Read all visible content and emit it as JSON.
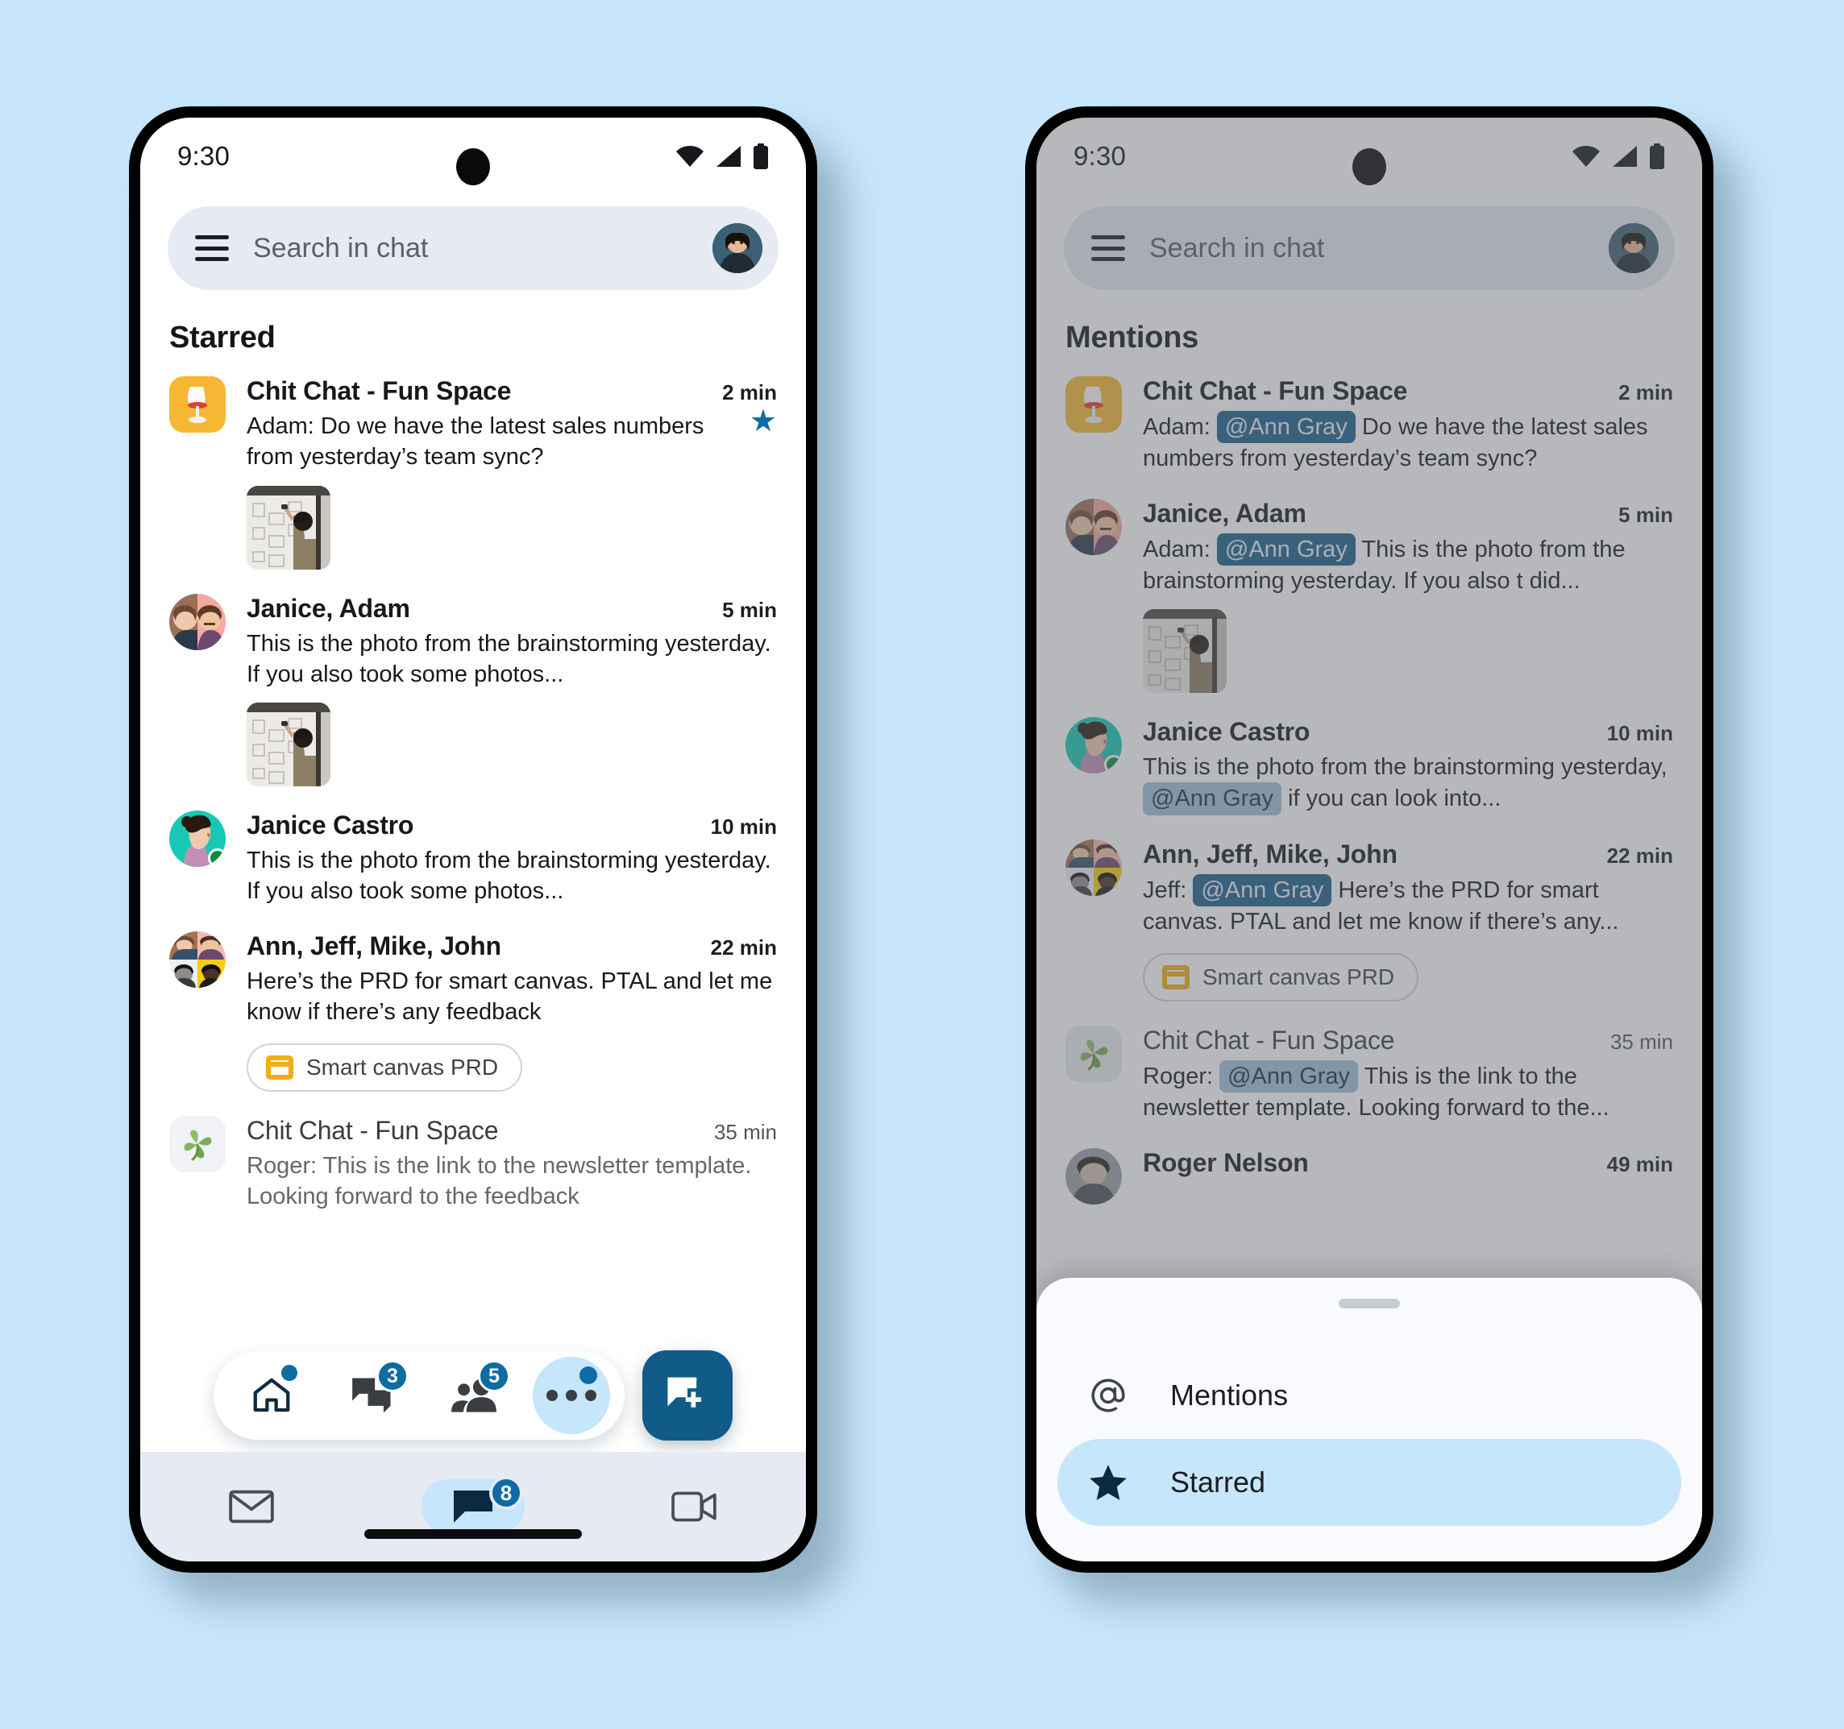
{
  "background_color": "#c7e6fb",
  "accent_color": "#0e6ba3",
  "phones": [
    {
      "id": "starred-phone",
      "status_bar": {
        "time": "9:30",
        "icons": [
          "wifi-icon",
          "signal-icon",
          "battery-icon"
        ]
      },
      "search": {
        "placeholder": "Search in chat",
        "menu_icon": "hamburger-icon",
        "avatar": "user-avatar"
      },
      "section_title": "Starred",
      "rows": [
        {
          "avatar": {
            "type": "square",
            "bg": "#f6b733",
            "glyph": "chair-icon"
          },
          "name": "Chit Chat - Fun Space",
          "time": "2 min",
          "snippet": "Adam: Do we have the latest sales numbers from yesterday’s team sync?",
          "starred": true,
          "has_thumb": true,
          "read": false
        },
        {
          "avatar": {
            "type": "split"
          },
          "name": "Janice, Adam",
          "time": "5 min",
          "snippet": "This is the photo from the brainstorming yesterday. If you also took some photos...",
          "starred": false,
          "has_thumb": true,
          "read": false
        },
        {
          "avatar": {
            "type": "circle",
            "bg": "#17c9b5"
          },
          "name": "Janice Castro",
          "time": "10 min",
          "snippet": "This is the photo from the brainstorming yesterday. If you also took some photos...",
          "starred": false,
          "has_thumb": false,
          "online": true,
          "read": false
        },
        {
          "avatar": {
            "type": "quad"
          },
          "name": "Ann, Jeff, Mike, John",
          "time": "22 min",
          "snippet": "Here’s the PRD for smart canvas. PTAL and let me know if there’s any feedback",
          "starred": false,
          "has_thumb": false,
          "attachment": "Smart canvas PRD",
          "read": false
        },
        {
          "avatar": {
            "type": "square",
            "bg": "#f0f2f5",
            "glyph": "clover-icon"
          },
          "name": "Chit Chat - Fun Space",
          "time": "35 min",
          "snippet": "Roger: This is the link to the newsletter template. Looking forward to the feedback",
          "starred": false,
          "has_thumb": false,
          "read": true
        }
      ],
      "nav_pill": [
        {
          "icon": "home-icon",
          "badge": "",
          "badge_dot": true
        },
        {
          "icon": "chat-bubbles-icon",
          "badge": "3",
          "badge_dot": false
        },
        {
          "icon": "people-icon",
          "badge": "5",
          "badge_dot": false
        },
        {
          "icon": "more-dots-icon",
          "badge": "",
          "badge_dot": true
        }
      ],
      "fab": {
        "icon": "new-chat-icon"
      },
      "tabs": [
        {
          "icon": "mail-icon",
          "label": "Mail",
          "active": false,
          "badge": ""
        },
        {
          "icon": "chat-icon",
          "label": "Chat",
          "active": true,
          "badge": "8"
        },
        {
          "icon": "video-icon",
          "label": "Meet",
          "active": false,
          "badge": ""
        }
      ]
    },
    {
      "id": "mentions-phone",
      "status_bar": {
        "time": "9:30",
        "icons": [
          "wifi-icon",
          "signal-icon",
          "battery-icon"
        ]
      },
      "search": {
        "placeholder": "Search in chat",
        "menu_icon": "hamburger-icon",
        "avatar": "user-avatar"
      },
      "section_title": "Mentions",
      "rows": [
        {
          "avatar": {
            "type": "square",
            "bg": "#f6b733",
            "glyph": "chair-icon"
          },
          "name": "Chit Chat - Fun Space",
          "time": "2 min",
          "prefix": "Adam: ",
          "mention": "@Ann Gray",
          "mention_style": "strong",
          "snippet": " Do we have the latest sales numbers from yesterday’s team sync?",
          "has_thumb": false,
          "read": false
        },
        {
          "avatar": {
            "type": "split"
          },
          "name": "Janice, Adam",
          "time": "5 min",
          "prefix": "Adam: ",
          "mention": "@Ann Gray",
          "mention_style": "strong",
          "snippet": " This is the photo from the brainstorming yesterday. If you also t  did...",
          "has_thumb": true,
          "read": false
        },
        {
          "avatar": {
            "type": "circle",
            "bg": "#17c9b5"
          },
          "name": "Janice Castro",
          "time": "10 min",
          "prefix": "This is the photo from the brainstorming yesterday, ",
          "mention": "@Ann Gray",
          "mention_style": "soft",
          "snippet": " if you can look into...",
          "has_thumb": false,
          "online": true,
          "read": false
        },
        {
          "avatar": {
            "type": "quad"
          },
          "name": "Ann, Jeff, Mike, John",
          "time": "22 min",
          "prefix": "Jeff: ",
          "mention": "@Ann Gray",
          "mention_style": "strong",
          "snippet": " Here’s the PRD for smart canvas. PTAL and let me know if there’s any...",
          "has_thumb": false,
          "attachment": "Smart canvas PRD",
          "read": false
        },
        {
          "avatar": {
            "type": "square",
            "bg": "#f0f2f5",
            "glyph": "clover-icon"
          },
          "name": "Chit Chat - Fun Space",
          "time": "35 min",
          "prefix": "Roger: ",
          "mention": "@Ann Gray",
          "mention_style": "soft",
          "snippet": " This is the link to the newsletter template. Looking forward to the...",
          "has_thumb": false,
          "read": true
        },
        {
          "avatar": {
            "type": "circle",
            "bg": "#8b8f96"
          },
          "name": "Roger Nelson",
          "time": "49 min",
          "prefix": "",
          "mention": "",
          "mention_style": "strong",
          "snippet": "",
          "has_thumb": false,
          "read": false
        }
      ],
      "sheet": {
        "handle": "drag-handle",
        "items": [
          {
            "icon": "at-icon",
            "label": "Mentions",
            "selected": false
          },
          {
            "icon": "star-icon",
            "label": "Starred",
            "selected": true
          }
        ]
      }
    }
  ]
}
